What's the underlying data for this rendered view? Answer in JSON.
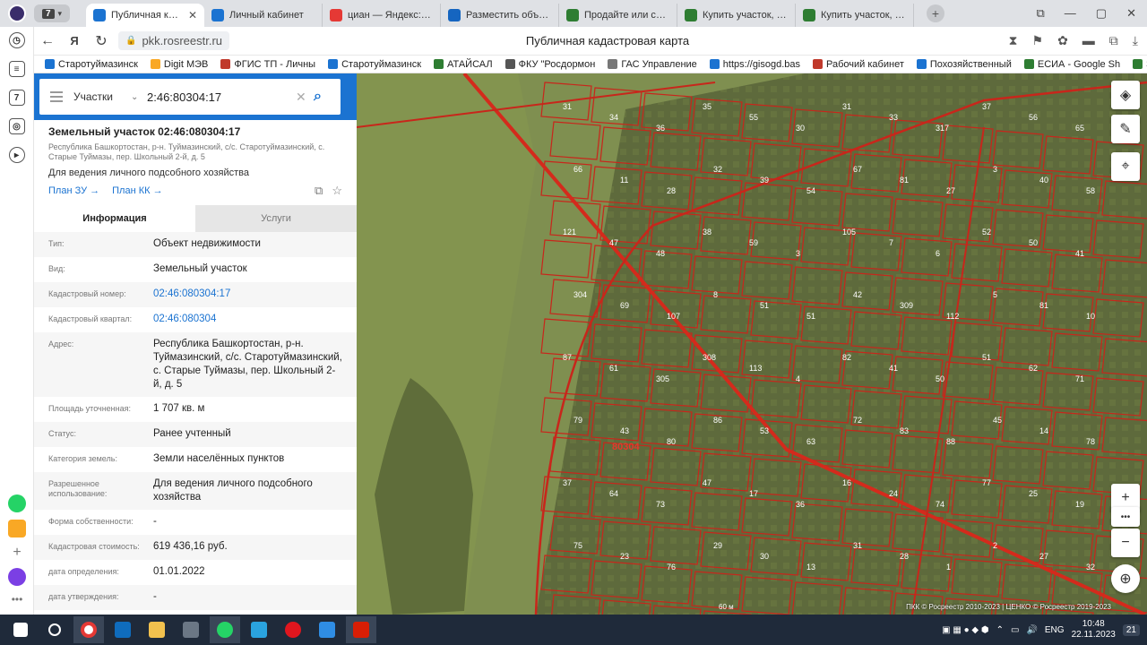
{
  "browser": {
    "tabs": [
      {
        "label": "Публичная кадаст",
        "active": true,
        "color": "#1b73d1"
      },
      {
        "label": "Личный кабинет",
        "active": false,
        "color": "#1b73d1"
      },
      {
        "label": "циан — Яндекс: наш",
        "active": false,
        "color": "#e53935"
      },
      {
        "label": "Разместить объявле",
        "active": false,
        "color": "#1565c0"
      },
      {
        "label": "Продайте или сдайт",
        "active": false,
        "color": "#2e7d32"
      },
      {
        "label": "Купить участок, 10 с",
        "active": false,
        "color": "#2e7d32"
      },
      {
        "label": "Купить участок, 17 с",
        "active": false,
        "color": "#2e7d32"
      }
    ],
    "tab_counter": "7",
    "url": "pkk.rosreestr.ru",
    "page_title": "Публичная кадастровая карта",
    "bookmarks": [
      "Старотуймазинск",
      "Digit МЭВ",
      "ФГИС ТП - Личны",
      "Старотуймазинск",
      "АТАЙСАЛ",
      "ФКУ \"Росдормон",
      "ГАС Управление",
      "https://gisogd.bas",
      "Рабочий кабинет",
      "Похозяйственный",
      "ЕСИА - Google Sh",
      "Земл"
    ]
  },
  "search": {
    "type_label": "Участки",
    "query": "2:46:80304:17"
  },
  "object": {
    "title": "Земельный участок 02:46:080304:17",
    "address_short": "Республика Башкортостан, р-н. Туймазинский, с/с. Старотуймазинский, с. Старые Туймазы, пер. Школьный 2-й, д. 5",
    "purpose": "Для ведения личного подсобного хозяйства",
    "link_zu": "План ЗУ →",
    "link_kk": "План КК →"
  },
  "info_tabs": {
    "info": "Информация",
    "services": "Услуги"
  },
  "rows": [
    {
      "key": "Тип:",
      "value": "Объект недвижимости",
      "link": false
    },
    {
      "key": "Вид:",
      "value": "Земельный участок",
      "link": false
    },
    {
      "key": "Кадастровый номер:",
      "value": "02:46:080304:17",
      "link": true
    },
    {
      "key": "Кадастровый квартал:",
      "value": "02:46:080304",
      "link": true
    },
    {
      "key": "Адрес:",
      "value": "Республика Башкортостан, р-н. Туймазинский, с/с. Старотуймазинский, с. Старые Туймазы, пер. Школьный 2-й, д. 5",
      "link": false
    },
    {
      "key": "Площадь уточненная:",
      "value": "1 707 кв. м",
      "link": false
    },
    {
      "key": "Статус:",
      "value": "Ранее учтенный",
      "link": false
    },
    {
      "key": "Категория земель:",
      "value": "Земли населённых пунктов",
      "link": false
    },
    {
      "key": "Разрешенное использование:",
      "value": "Для ведения личного подсобного хозяйства",
      "link": false
    },
    {
      "key": "Форма собственности:",
      "value": "-",
      "link": false
    },
    {
      "key": "Кадастровая стоимость:",
      "value": "619 436,16 руб.",
      "link": false
    },
    {
      "key": "дата определения:",
      "value": "01.01.2022",
      "link": false
    },
    {
      "key": "дата утверждения:",
      "value": "-",
      "link": false
    }
  ],
  "map": {
    "quarter_label": "80304",
    "parcel_numbers": [
      "31",
      "34",
      "36",
      "35",
      "55",
      "30",
      "31",
      "33",
      "317",
      "37",
      "56",
      "65",
      "66",
      "11",
      "28",
      "32",
      "39",
      "54",
      "67",
      "81",
      "27",
      "3",
      "40",
      "58",
      "121",
      "47",
      "48",
      "38",
      "59",
      "3",
      "105",
      "7",
      "6",
      "52",
      "50",
      "41",
      "304",
      "69",
      "107",
      "8",
      "51",
      "51",
      "42",
      "309",
      "112",
      "5",
      "81",
      "10",
      "87",
      "61",
      "305",
      "308",
      "113",
      "4",
      "82",
      "41",
      "50",
      "51",
      "62",
      "71",
      "79",
      "43",
      "80",
      "86",
      "53",
      "63",
      "72",
      "83",
      "88",
      "45",
      "14",
      "78",
      "37",
      "64",
      "73",
      "47",
      "17",
      "36",
      "16",
      "24",
      "74",
      "77",
      "25",
      "19",
      "75",
      "23",
      "76",
      "29",
      "30",
      "13",
      "31",
      "28",
      "1",
      "2",
      "27",
      "32"
    ],
    "scale_label": "60 м",
    "copyright": "ПКК © Росреестр 2010-2023 | ЦЕНКО © Росреестр 2019-2023"
  },
  "taskbar": {
    "lang": "ENG",
    "time": "10:48",
    "date": "22.11.2023",
    "notif": "21"
  }
}
